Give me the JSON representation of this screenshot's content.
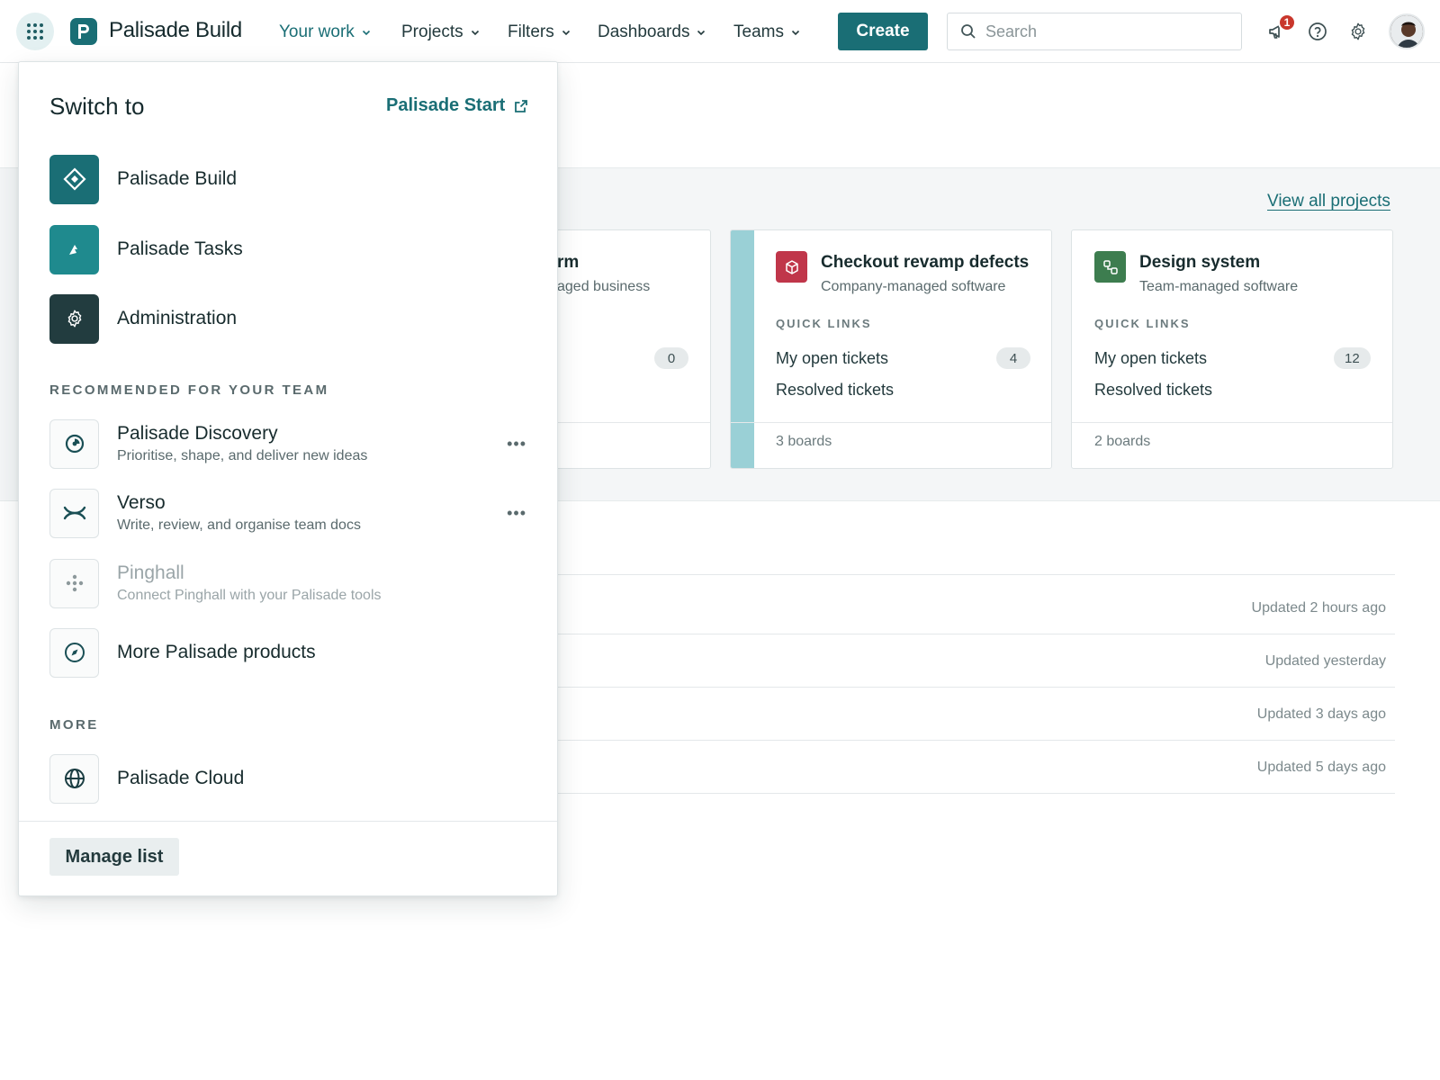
{
  "nav": {
    "logo_text": "Palisade Build",
    "items": [
      {
        "label": "Your work",
        "active": true
      },
      {
        "label": "Projects",
        "active": false
      },
      {
        "label": "Filters",
        "active": false
      },
      {
        "label": "Dashboards",
        "active": false
      },
      {
        "label": "Teams",
        "active": false
      }
    ],
    "create_label": "Create",
    "search_placeholder": "Search",
    "notifications_count": "1",
    "icons": [
      "app-grid-icon",
      "megaphone-icon",
      "help-icon",
      "gear-icon"
    ]
  },
  "main": {
    "view_all_projects": "View all projects",
    "cards": [
      {
        "title_fragment": "rm",
        "subtitle_fragment": "aged business",
        "count": "0"
      },
      {
        "title": "Checkout revamp defects",
        "subtitle": "Company-managed software",
        "quick_links_label": "QUICK LINKS",
        "links": [
          {
            "label": "My open tickets",
            "count": "4"
          },
          {
            "label": "Resolved tickets"
          }
        ],
        "boards": "3 boards",
        "icon_color": "#c0364a"
      },
      {
        "title": "Design system",
        "subtitle": "Team-managed software",
        "quick_links_label": "QUICK LINKS",
        "links": [
          {
            "label": "My open tickets",
            "count": "12"
          },
          {
            "label": "Resolved tickets"
          }
        ],
        "boards": "2 boards",
        "icon_color": "#3d7d4f"
      }
    ],
    "updates": [
      "Updated 2 hours ago",
      "Updated yesterday",
      "Updated 3 days ago",
      "Updated 5 days ago"
    ]
  },
  "switcher": {
    "title": "Switch to",
    "start_link": "Palisade Start",
    "apps": [
      {
        "name": "Palisade Build",
        "icon": "diamond-icon",
        "color": "#1a6e75"
      },
      {
        "name": "Palisade Tasks",
        "icon": "tasks-icon",
        "color": "#1f8a8e"
      },
      {
        "name": "Administration",
        "icon": "gear-icon",
        "color": "#223c3f"
      }
    ],
    "recommended_label": "RECOMMENDED FOR YOUR TEAM",
    "recommended": [
      {
        "name": "Palisade Discovery",
        "desc": "Prioritise, shape, and deliver new ideas",
        "icon": "discovery-icon"
      },
      {
        "name": "Verso",
        "desc": "Write, review, and organise team docs",
        "icon": "verso-icon"
      },
      {
        "name": "Pinghall",
        "desc": "Connect Pinghall with your Palisade tools",
        "icon": "pinghall-icon"
      },
      {
        "name": "More Palisade products",
        "icon": "compass-icon"
      }
    ],
    "more_label": "MORE",
    "more": [
      {
        "name": "Palisade Cloud",
        "icon": "globe-icon"
      }
    ],
    "manage_label": "Manage list"
  }
}
